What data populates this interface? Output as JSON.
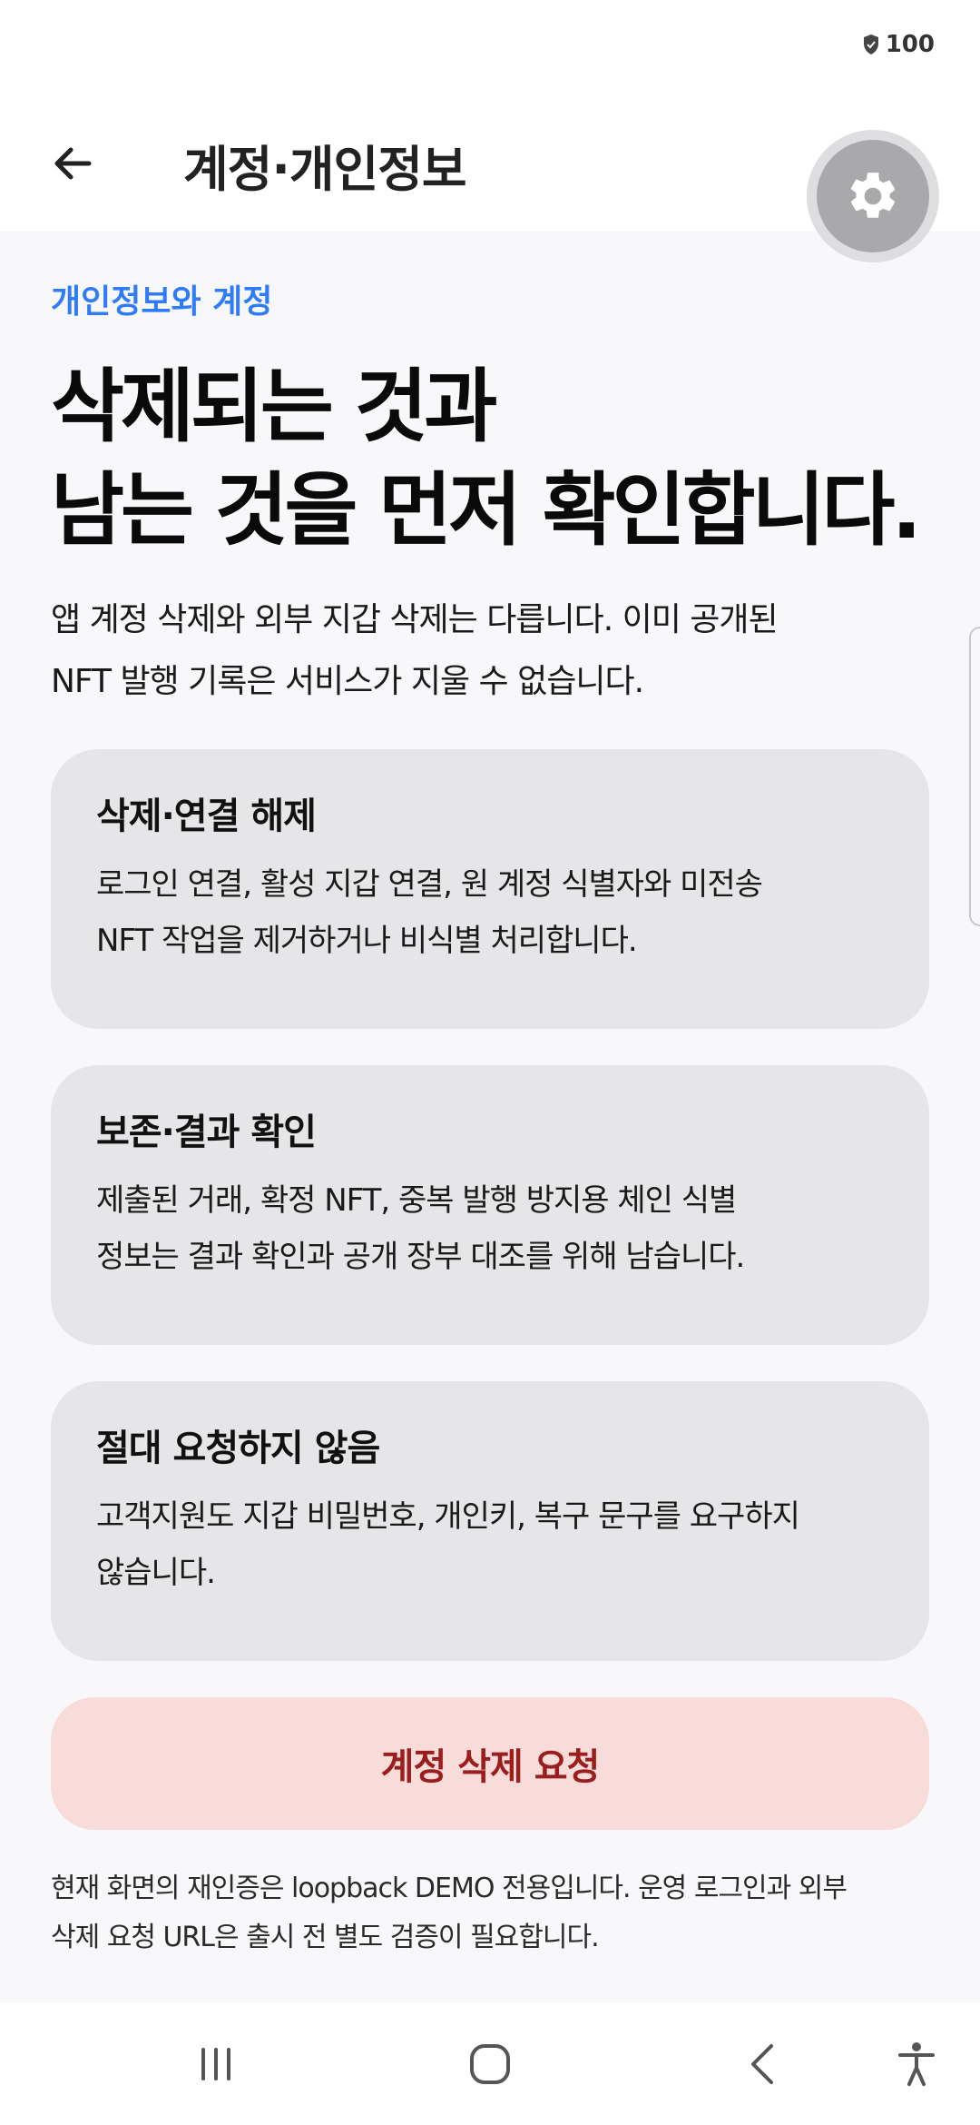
{
  "status_bar": {
    "battery_level": "100",
    "battery_icon": "shield-battery-icon"
  },
  "app_bar": {
    "title": "계정·개인정보",
    "back_icon": "arrow-left-icon"
  },
  "settings_fab": {
    "icon": "gear-icon"
  },
  "main": {
    "eyebrow": "개인정보와 계정",
    "headline_line1": "삭제되는 것과",
    "headline_line2": "남는 것을 먼저 확인합니다.",
    "intro_line1": "앱 계정 삭제와 외부 지갑 삭제는 다릅니다. 이미 공개된",
    "intro_line2": "NFT 발행 기록은 서비스가 지울 수 없습니다.",
    "cards": [
      {
        "title": "삭제·연결 해제",
        "body_line1": "로그인 연결, 활성 지갑 연결, 원 계정 식별자와 미전송",
        "body_line2": "NFT 작업을 제거하거나 비식별 처리합니다."
      },
      {
        "title": "보존·결과 확인",
        "body_line1": "제출된 거래, 확정 NFT, 중복 발행 방지용 체인 식별",
        "body_line2": "정보는 결과 확인과 공개 장부 대조를 위해 남습니다."
      },
      {
        "title": "절대 요청하지 않음",
        "body_line1": "고객지원도 지갑 비밀번호, 개인키, 복구 문구를 요구하지",
        "body_line2": "않습니다."
      }
    ],
    "delete_button_label": "계정 삭제 요청",
    "footnote_line1": "현재 화면의 재인증은 loopback DEMO 전용입니다. 운영 로그인과 외부",
    "footnote_line2": "삭제 요청 URL은 출시 전 별도 검증이 필요합니다."
  },
  "nav_bar": {
    "recents_icon": "recents-icon",
    "home_icon": "home-icon",
    "back_icon": "back-chevron-icon",
    "accessibility_icon": "accessibility-icon"
  },
  "colors": {
    "accent": "#2f7cf6",
    "danger_text": "#9a1e1e",
    "danger_bg": "#f8dcda",
    "card_bg": "#e6e6e8",
    "page_bg": "#f8f8fb"
  }
}
